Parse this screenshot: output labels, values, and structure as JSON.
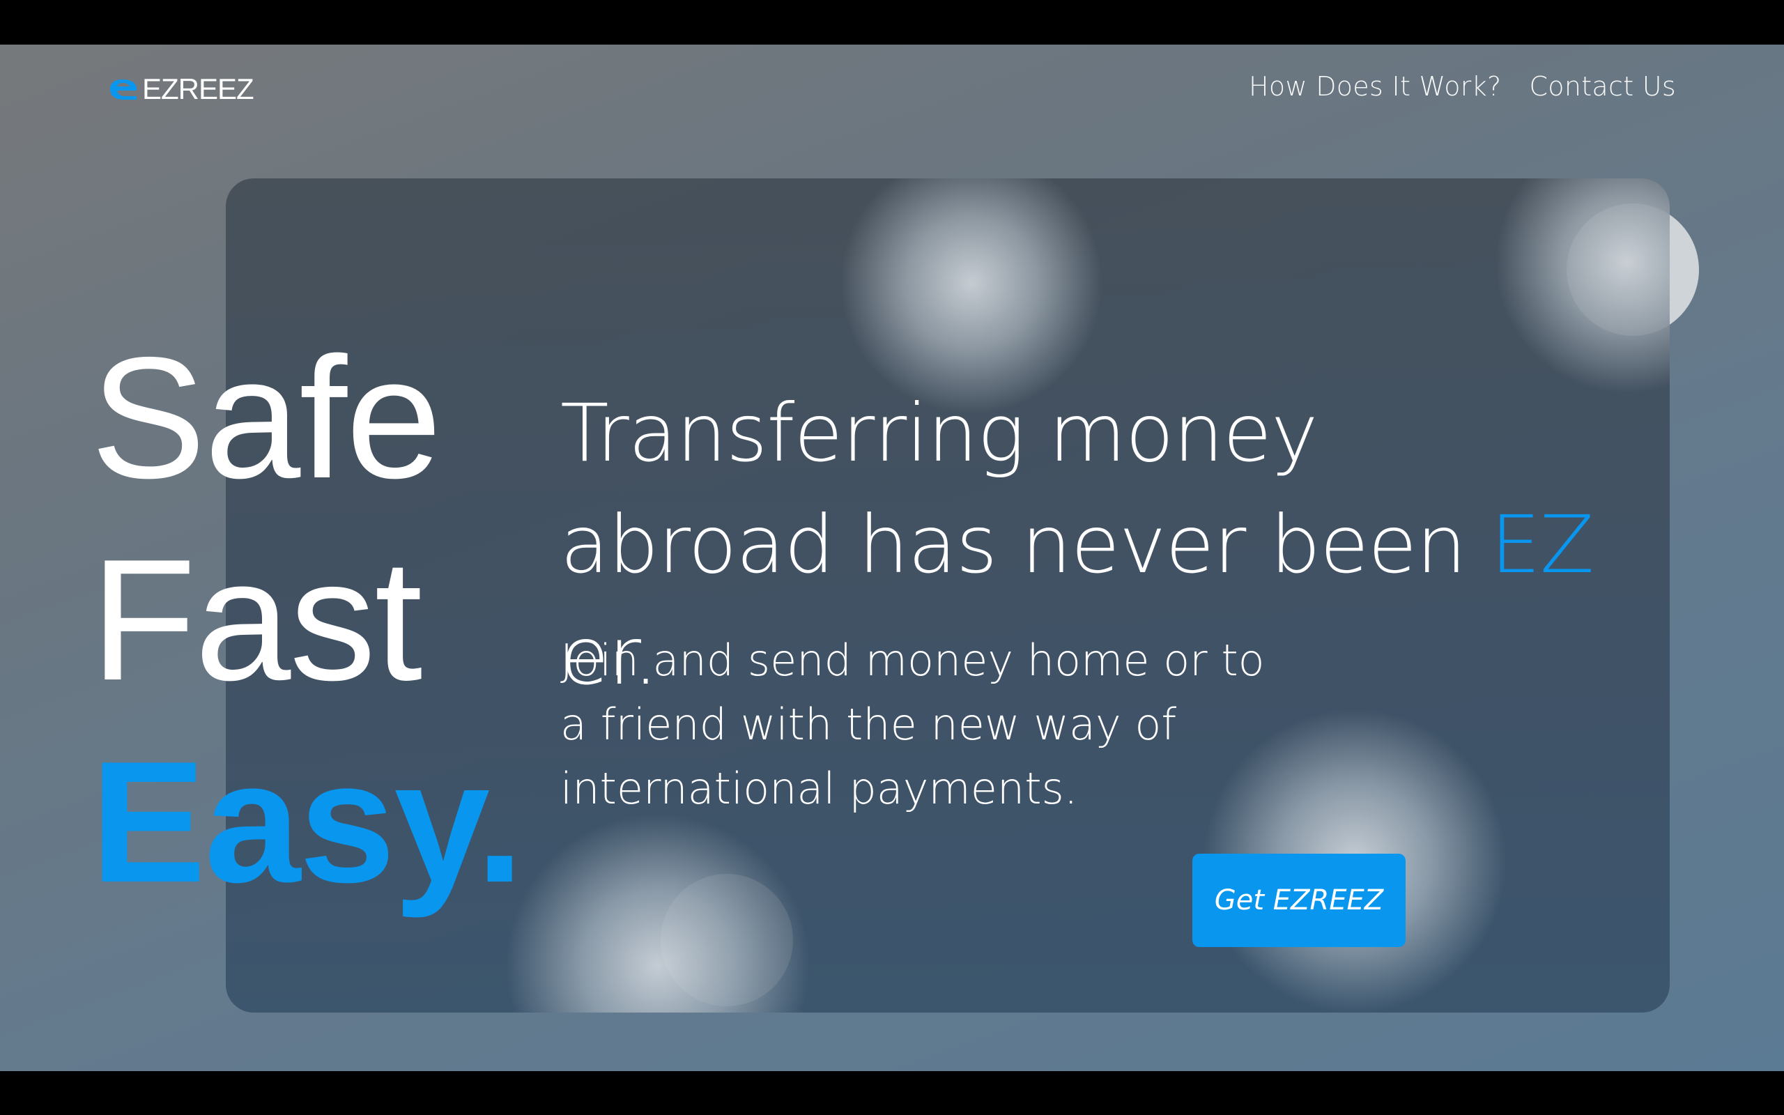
{
  "brand": {
    "logo_text": "EZREEZ",
    "accent_color": "#0896ee",
    "logo_icon": "e-logo-icon"
  },
  "nav": {
    "items": [
      {
        "label": "How Does It Work?"
      },
      {
        "label": "Contact Us"
      }
    ]
  },
  "hero": {
    "words": [
      "Safe",
      "Fast",
      "Easy."
    ],
    "headline_part1": "Transferring money abroad has never been ",
    "headline_highlight": "EZ",
    "headline_part2": " er.",
    "subtext": "Join and send money home or to a friend with the new way of international payments.",
    "cta_label": "Get EZREEZ"
  }
}
